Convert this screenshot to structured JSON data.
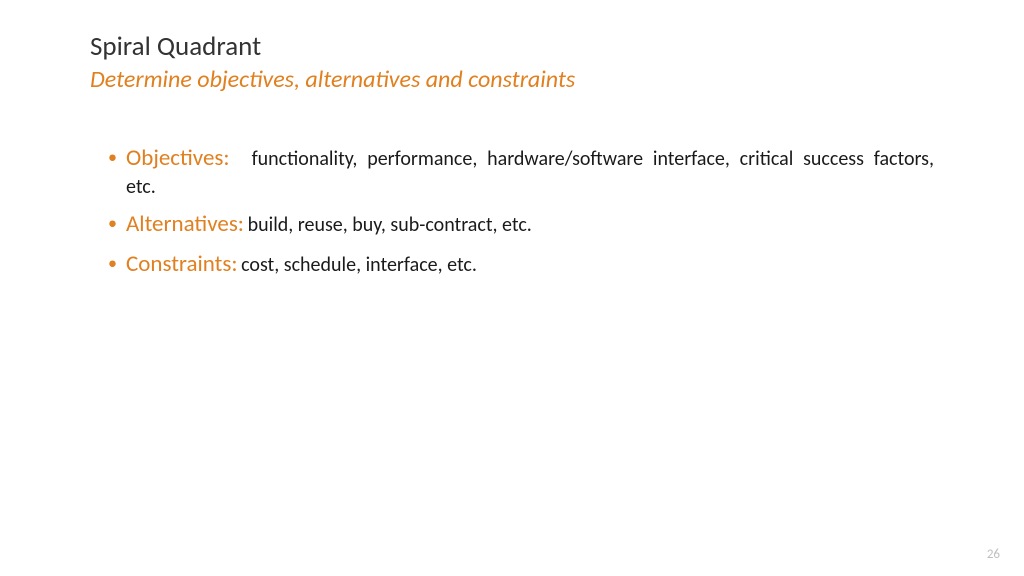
{
  "title": "Spiral Quadrant",
  "subtitle": "Determine objectives, alternatives and constraints",
  "bullets": [
    {
      "label": "Objectives:",
      "desc": "functionality, performance, hardware/software interface, critical success factors, etc."
    },
    {
      "label": "Alternatives:",
      "desc": "build, reuse, buy, sub-contract, etc."
    },
    {
      "label": "Constraints:",
      "desc": "cost, schedule, interface, etc."
    }
  ],
  "pageNumber": "26"
}
